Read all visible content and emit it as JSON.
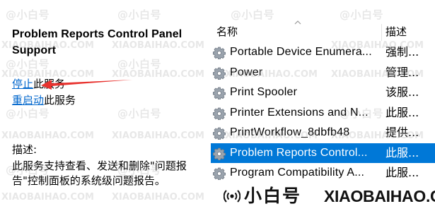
{
  "left": {
    "title": "Problem Reports Control Panel Support",
    "stop_link": "停止",
    "stop_suffix": "此服务",
    "restart_link": "重启动",
    "restart_suffix": "此服务",
    "description_label": "描述:",
    "description_text": "此服务支持查看、发送和删除\"问题报告\"控制面板的系统级问题报告。"
  },
  "list": {
    "header_name": "名称",
    "header_desc": "描述",
    "rows": [
      {
        "name": "Portable Device Enumera...",
        "desc": "强制..."
      },
      {
        "name": "Power",
        "desc": "管理..."
      },
      {
        "name": "Print Spooler",
        "desc": "该服..."
      },
      {
        "name": "Printer Extensions and N...",
        "desc": "此服..."
      },
      {
        "name": "PrintWorkflow_8dbfb48",
        "desc": "提供..."
      },
      {
        "name": "Problem Reports Control...",
        "desc": "此服..."
      },
      {
        "name": "Program Compatibility A...",
        "desc": "此服..."
      }
    ],
    "selected_index": 5
  },
  "colors": {
    "link": "#0066cc",
    "selection": "#0078d7",
    "annotation_arrow": "#e8332f"
  },
  "watermark": {
    "cn": "@小白号",
    "en": "XIAOBAIHAO.COM",
    "brand_cn": "小白号",
    "brand_en": "XIAOBAIHAO.COM"
  },
  "icons": {
    "service": "gear-icon",
    "brand": "broadcast-icon"
  }
}
